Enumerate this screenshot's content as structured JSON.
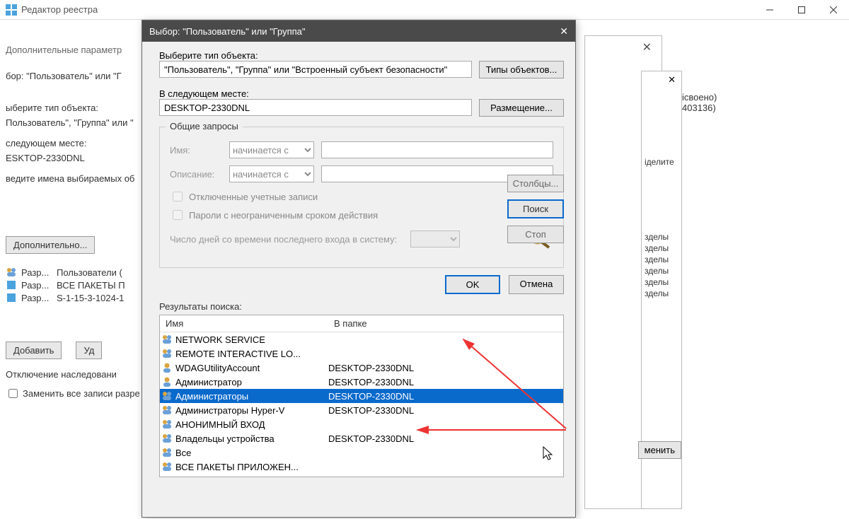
{
  "main_window": {
    "title": "Редактор реестра"
  },
  "secondary_bar": {
    "title": "Дополнительные параметр",
    "sel_crumb": "бор: \"Пользователь\" или \"Г"
  },
  "underlay": {
    "obj_type_label": "ыберите тип объекта:",
    "obj_type_value": "Пользователь\", \"Группа\" или \"",
    "loc_label": "следующем месте:",
    "loc_value": "ESKTOP-2330DNL",
    "names_label": "ведите имена выбираемых об",
    "advanced_btn": "Дополнительно...",
    "perms": [
      {
        "type": "Разр...",
        "who": "Пользователи ("
      },
      {
        "type": "Разр...",
        "who": "ВСЕ ПАКЕТЫ П"
      },
      {
        "type": "Разр...",
        "who": "S-1-15-3-1024-1"
      }
    ],
    "add_btn": "Добавить",
    "remove_btn": "Уд",
    "inherit_label": "Отключение наследовани",
    "replace_label": "Заменить все записи разре"
  },
  "dialog": {
    "title": "Выбор: \"Пользователь\" или \"Группа\"",
    "obj_type_label": "Выберите тип объекта:",
    "obj_type_value": "\"Пользователь\", \"Группа\" или \"Встроенный субъект безопасности\"",
    "obj_types_btn": "Типы объектов...",
    "loc_label": "В следующем месте:",
    "loc_value": "DESKTOP-2330DNL",
    "loc_btn": "Размещение...",
    "group_title": "Общие запросы",
    "name_label": "Имя:",
    "name_starts": "начинается с",
    "desc_label": "Описание:",
    "desc_starts": "начинается с",
    "chk_disabled": "Отключенные учетные записи",
    "chk_pwdexpire": "Пароли с неограниченным сроком действия",
    "days_label": "Число дней со времени последнего входа в систему:",
    "columns_btn": "Столбцы...",
    "search_btn": "Поиск",
    "stop_btn": "Стоп",
    "ok_btn": "OK",
    "cancel_btn": "Отмена",
    "results_label": "Результаты поиска:",
    "col_name": "Имя",
    "col_folder": "В папке",
    "results": [
      {
        "name": "NETWORK SERVICE",
        "folder": "",
        "kind": "group"
      },
      {
        "name": "REMOTE INTERACTIVE LO...",
        "folder": "",
        "kind": "group"
      },
      {
        "name": "WDAGUtilityAccount",
        "folder": "DESKTOP-2330DNL",
        "kind": "user"
      },
      {
        "name": "Администратор",
        "folder": "DESKTOP-2330DNL",
        "kind": "user"
      },
      {
        "name": "Администраторы",
        "folder": "DESKTOP-2330DNL",
        "kind": "group",
        "selected": true
      },
      {
        "name": "Администраторы Hyper-V",
        "folder": "DESKTOP-2330DNL",
        "kind": "group"
      },
      {
        "name": "АНОНИМНЫЙ ВХОД",
        "folder": "",
        "kind": "group"
      },
      {
        "name": "Владельцы устройства",
        "folder": "DESKTOP-2330DNL",
        "kind": "group"
      },
      {
        "name": "Все",
        "folder": "",
        "kind": "group"
      },
      {
        "name": "ВСЕ ПАКЕТЫ ПРИЛОЖЕН...",
        "folder": "",
        "kind": "group"
      }
    ]
  },
  "right_frag": {
    "line1": "ісвоено)",
    "line2": "403136)",
    "assign_hint": "іделите",
    "rows": [
      "зделы",
      "зделы",
      "зделы",
      "зделы",
      "зделы",
      "зделы"
    ],
    "apply_btn": "менить"
  }
}
